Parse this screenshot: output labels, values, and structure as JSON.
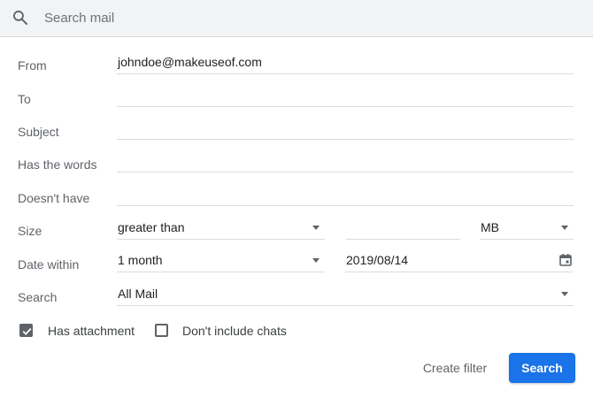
{
  "search": {
    "placeholder": "Search mail"
  },
  "form": {
    "from": {
      "label": "From",
      "value": "johndoe@makeuseof.com"
    },
    "to": {
      "label": "To",
      "value": ""
    },
    "subject": {
      "label": "Subject",
      "value": ""
    },
    "has_words": {
      "label": "Has the words",
      "value": ""
    },
    "doesnt_have": {
      "label": "Doesn't have",
      "value": ""
    },
    "size": {
      "label": "Size",
      "operator": "greater than",
      "value": "",
      "unit": "MB"
    },
    "date_within": {
      "label": "Date within",
      "range": "1 month",
      "date": "2019/08/14"
    },
    "search_in": {
      "label": "Search",
      "value": "All Mail"
    },
    "has_attachment": {
      "label": "Has attachment",
      "checked": true
    },
    "exclude_chats": {
      "label": "Don't include chats",
      "checked": false
    }
  },
  "actions": {
    "create_filter": "Create filter",
    "search": "Search"
  },
  "colors": {
    "primary": "#1a73e8",
    "searchbar_bg": "#f1f3f4",
    "divider": "#dadce0"
  },
  "icons": {
    "search": "search-icon",
    "calendar": "calendar-icon",
    "dropdown": "dropdown-arrow-icon",
    "check": "checkmark-icon"
  }
}
